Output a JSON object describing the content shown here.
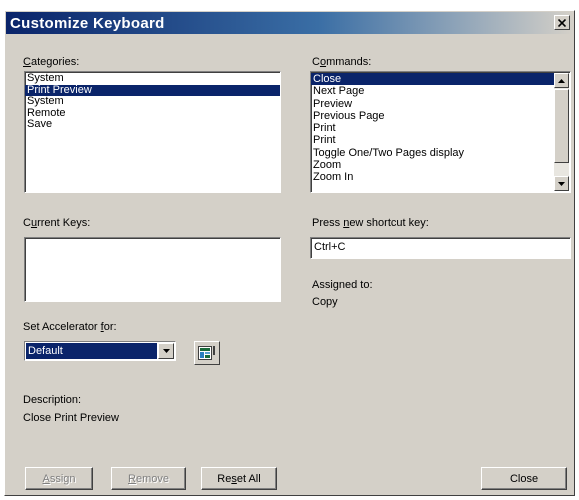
{
  "window": {
    "title": "Customize Keyboard",
    "close_glyph": "×"
  },
  "categories": {
    "label_access": "C",
    "label_rest": "ategories:",
    "items": [
      {
        "label": "System",
        "selected": false
      },
      {
        "label": "Print Preview",
        "selected": true
      },
      {
        "label": "System",
        "selected": false
      },
      {
        "label": "Remote",
        "selected": false
      },
      {
        "label": "Save",
        "selected": false
      }
    ]
  },
  "commands": {
    "label_pre": "C",
    "label_access": "o",
    "label_rest": "mmands:",
    "items": [
      {
        "label": "Close",
        "selected": true
      },
      {
        "label": "Next Page",
        "selected": false
      },
      {
        "label": "Preview",
        "selected": false
      },
      {
        "label": "Previous Page",
        "selected": false
      },
      {
        "label": "Print",
        "selected": false
      },
      {
        "label": "Print",
        "selected": false
      },
      {
        "label": "Toggle One/Two Pages display",
        "selected": false
      },
      {
        "label": "Zoom",
        "selected": false
      },
      {
        "label": "Zoom In",
        "selected": false
      }
    ]
  },
  "current_keys": {
    "label_pre": "C",
    "label_access": "u",
    "label_rest": "rrent Keys:"
  },
  "shortcut": {
    "label_pre": "Press ",
    "label_access": "n",
    "label_rest": "ew shortcut key:",
    "value": "Ctrl+C"
  },
  "assigned": {
    "label": "Assigned to:",
    "value": "Copy"
  },
  "accelerator": {
    "label_pre": "Set Accelerator ",
    "label_access": "f",
    "label_rest": "or:",
    "selected": "Default"
  },
  "description": {
    "label": "Description:",
    "value": "Close Print Preview"
  },
  "buttons": {
    "assign_access": "A",
    "assign_rest": "ssign",
    "remove_access": "R",
    "remove_rest": "emove",
    "reset_pre": "Re",
    "reset_access": "s",
    "reset_rest": "et All",
    "close": "Close"
  },
  "icons": {
    "close": "close-icon",
    "scroll_up": "arrow-up-icon",
    "scroll_down": "arrow-down-icon",
    "dropdown": "chevron-down-icon",
    "accelerator_icon": "keyboard-accelerator-icon"
  },
  "colors": {
    "title_start": "#0a246a",
    "title_end": "#3a6ea5",
    "selection": "#0a246a",
    "face": "#d4d0c8"
  }
}
